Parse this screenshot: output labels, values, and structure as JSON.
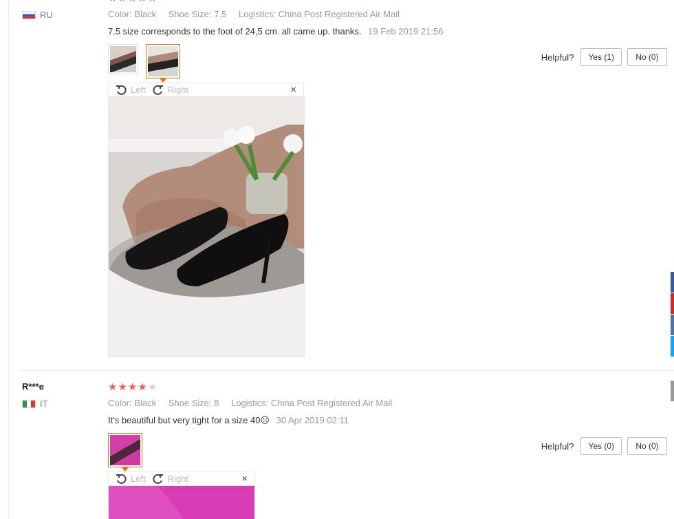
{
  "review1": {
    "country": "RU",
    "rating": 5,
    "color_key": "Color:",
    "color_val": "Black",
    "size_key": "Shoe Size:",
    "size_val": "7.5",
    "logistics_key": "Logistics:",
    "logistics_val": "China Post Registered Air Mail",
    "feedback": "7.5 size corresponds to the foot of 24,5 cm. all came up. thanks.",
    "date": "19 Feb 2019 21:56",
    "helpful_label": "Helpful?",
    "yes_label": "Yes (1)",
    "no_label": "No (0)",
    "rotate_left": "Left",
    "rotate_right": "Right",
    "close": "×"
  },
  "review2": {
    "user": "R***e",
    "country": "IT",
    "rating": 4,
    "color_key": "Color:",
    "color_val": "Black",
    "size_key": "Shoe Size:",
    "size_val": "8",
    "logistics_key": "Logistics:",
    "logistics_val": "China Post Registered Air Mail",
    "feedback": "It's beautiful but very tight for a size 40☹",
    "date": "30 Apr 2019 02:11",
    "helpful_label": "Helpful?",
    "yes_label": "Yes (0)",
    "no_label": "No (0)",
    "rotate_left": "Left",
    "rotate_right": "Right",
    "close": "×"
  },
  "colors": {
    "star_on": "#f0604f",
    "star_off": "#d3d3d3",
    "thumb_active": "#e0761a"
  },
  "side_tabs": [
    "#3b5998",
    "#c4302b",
    "#55acee",
    "#1da1f2",
    "#999999"
  ]
}
